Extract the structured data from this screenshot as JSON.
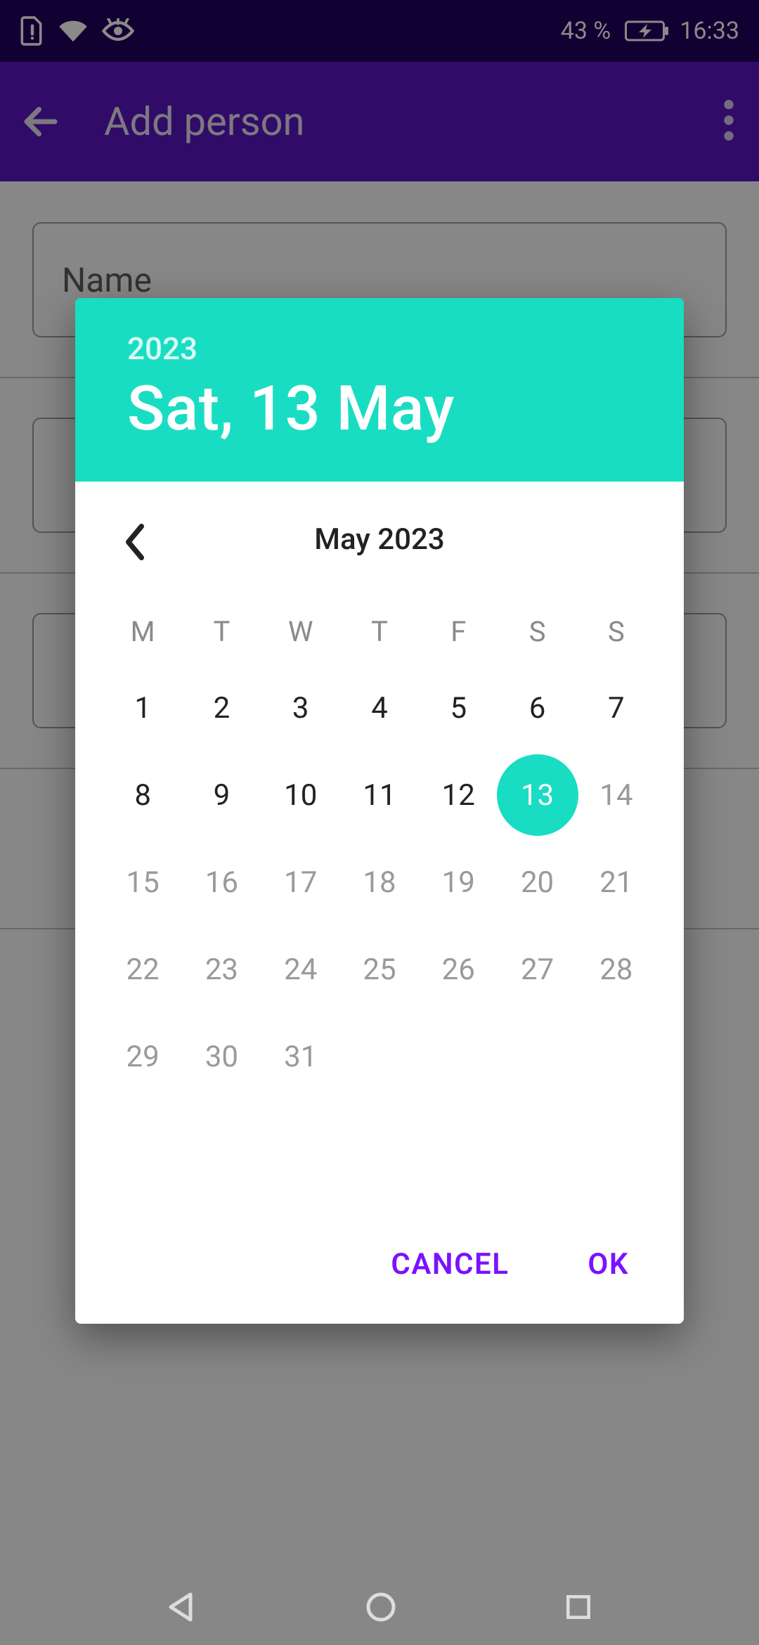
{
  "status": {
    "battery_text": "43 %",
    "time": "16:33"
  },
  "appbar": {
    "title": "Add person"
  },
  "form": {
    "name_placeholder": "Name"
  },
  "dialog": {
    "year": "2023",
    "headline": "Sat, 13 May",
    "month_label": "May 2023",
    "dow": [
      "M",
      "T",
      "W",
      "T",
      "F",
      "S",
      "S"
    ],
    "weeks": [
      [
        {
          "n": "1"
        },
        {
          "n": "2"
        },
        {
          "n": "3"
        },
        {
          "n": "4"
        },
        {
          "n": "5"
        },
        {
          "n": "6"
        },
        {
          "n": "7"
        }
      ],
      [
        {
          "n": "8"
        },
        {
          "n": "9"
        },
        {
          "n": "10"
        },
        {
          "n": "11"
        },
        {
          "n": "12"
        },
        {
          "n": "13",
          "sel": true
        },
        {
          "n": "14",
          "dim": true
        }
      ],
      [
        {
          "n": "15",
          "dim": true
        },
        {
          "n": "16",
          "dim": true
        },
        {
          "n": "17",
          "dim": true
        },
        {
          "n": "18",
          "dim": true
        },
        {
          "n": "19",
          "dim": true
        },
        {
          "n": "20",
          "dim": true
        },
        {
          "n": "21",
          "dim": true
        }
      ],
      [
        {
          "n": "22",
          "dim": true
        },
        {
          "n": "23",
          "dim": true
        },
        {
          "n": "24",
          "dim": true
        },
        {
          "n": "25",
          "dim": true
        },
        {
          "n": "26",
          "dim": true
        },
        {
          "n": "27",
          "dim": true
        },
        {
          "n": "28",
          "dim": true
        }
      ],
      [
        {
          "n": "29",
          "dim": true
        },
        {
          "n": "30",
          "dim": true
        },
        {
          "n": "31",
          "dim": true
        },
        {
          "n": ""
        },
        {
          "n": ""
        },
        {
          "n": ""
        },
        {
          "n": ""
        }
      ]
    ],
    "cancel": "CANCEL",
    "ok": "OK"
  }
}
